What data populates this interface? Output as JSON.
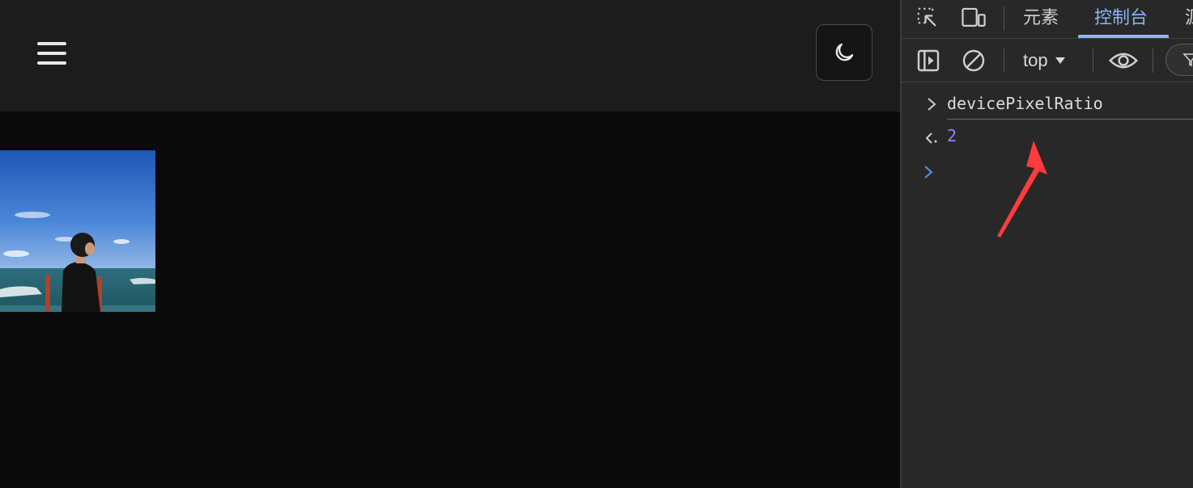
{
  "devtools": {
    "tabs": [
      {
        "label": "元素",
        "active": false
      },
      {
        "label": "控制台",
        "active": true
      },
      {
        "label": "源",
        "active": false
      }
    ],
    "toolbar": {
      "context_label": "top"
    },
    "console": {
      "input_expression": "devicePixelRatio",
      "result_value": "2"
    }
  },
  "colors": {
    "accent": "#8ab4f8",
    "result_number": "#9980ff",
    "annotation_arrow": "#ff3b3b"
  },
  "icons": {
    "menu": "hamburger-icon",
    "theme": "moon-icon",
    "inspect": "inspect-element-icon",
    "device": "device-toolbar-icon",
    "sidebar": "show-sidebar-icon",
    "clear": "clear-console-icon",
    "eye": "live-expression-icon",
    "filter": "filter-icon",
    "prompt": "chevron-right-icon",
    "result": "result-arrow-icon"
  }
}
